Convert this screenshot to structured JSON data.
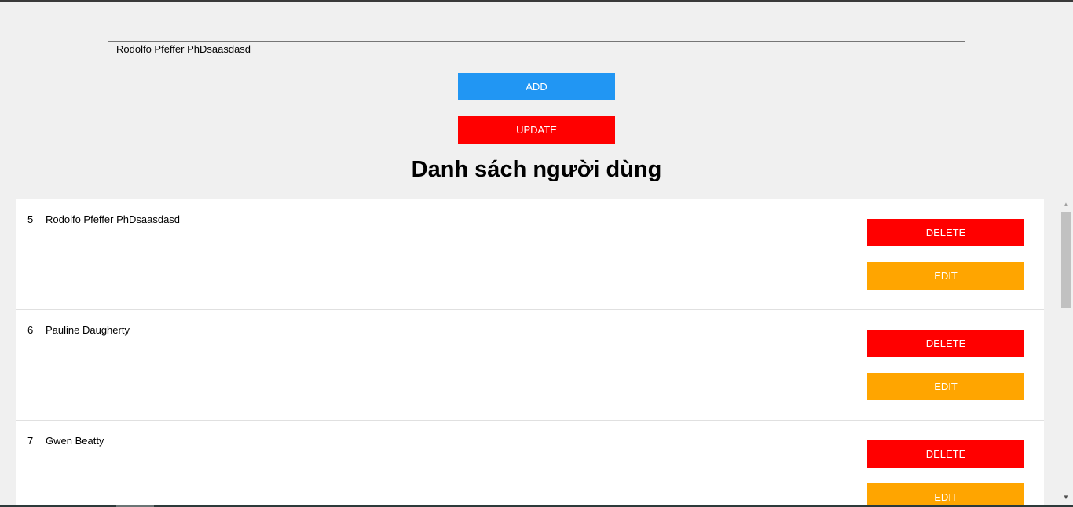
{
  "form": {
    "input_value": "Rodolfo Pfeffer PhDsaasdasd",
    "add_label": "ADD",
    "update_label": "UPDATE"
  },
  "header": {
    "title": "Danh sách người dùng"
  },
  "users": [
    {
      "id": "5",
      "name": "Rodolfo Pfeffer PhDsaasdasd",
      "delete_label": "DELETE",
      "edit_label": "EDIT"
    },
    {
      "id": "6",
      "name": "Pauline Daugherty",
      "delete_label": "DELETE",
      "edit_label": "EDIT"
    },
    {
      "id": "7",
      "name": "Gwen Beatty",
      "delete_label": "DELETE",
      "edit_label": "EDIT"
    }
  ],
  "scrollbar": {
    "up_glyph": "▲",
    "down_glyph": "▼"
  },
  "colors": {
    "add": "#2196f3",
    "update": "#ff0000",
    "delete": "#ff0000",
    "edit": "#ffa500"
  }
}
